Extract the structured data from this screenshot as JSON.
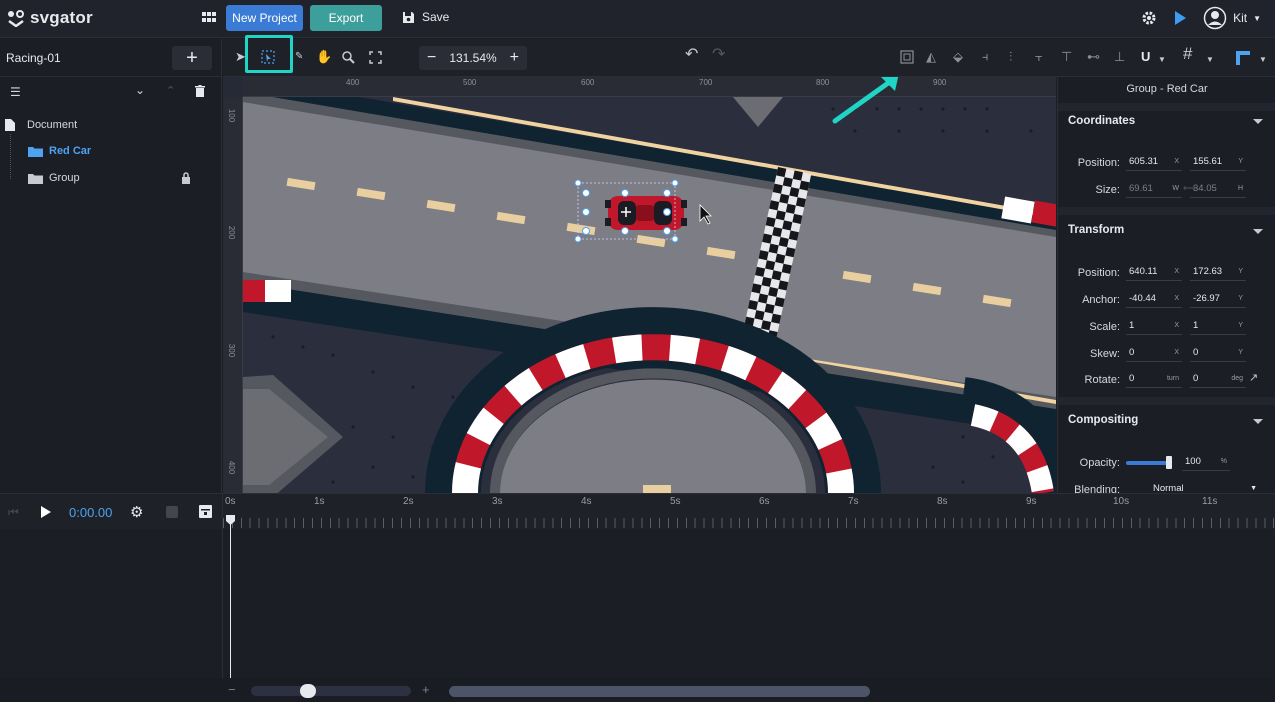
{
  "app": {
    "logo_text": "svgator"
  },
  "topbar": {
    "new_project": "New Project",
    "export": "Export",
    "save": "Save",
    "user": "Kit"
  },
  "project": {
    "name": "Racing-01"
  },
  "layers": [
    {
      "name": "Document",
      "selected": false
    },
    {
      "name": "Red Car",
      "selected": true
    },
    {
      "name": "Group",
      "locked": true
    }
  ],
  "toolbar": {
    "zoom": "131.54%"
  },
  "ruler": {
    "top": [
      "400",
      "500",
      "600",
      "700",
      "800",
      "900"
    ],
    "left": [
      "100",
      "200",
      "300",
      "400"
    ]
  },
  "inspector": {
    "title": "Group - Red Car",
    "coordinates": {
      "header": "Coordinates",
      "position_label": "Position:",
      "pos_x": "605.31",
      "pos_y": "155.61",
      "size_label": "Size:",
      "size_w": "69.61",
      "size_h": "34.05"
    },
    "transform": {
      "header": "Transform",
      "position_label": "Position:",
      "pos_x": "640.11",
      "pos_y": "172.63",
      "anchor_label": "Anchor:",
      "anchor_x": "-40.44",
      "anchor_y": "-26.97",
      "scale_label": "Scale:",
      "scale_x": "1",
      "scale_y": "1",
      "skew_label": "Skew:",
      "skew_x": "0",
      "skew_y": "0",
      "rotate_label": "Rotate:",
      "rotate_turn": "0",
      "rotate_deg": "0"
    },
    "compositing": {
      "header": "Compositing",
      "opacity_label": "Opacity:",
      "opacity_value": "100",
      "blending_label": "Blending:",
      "blending_value": "Normal"
    },
    "units": {
      "x": "X",
      "y": "Y",
      "w": "W",
      "h": "H",
      "turn": "turn",
      "deg": "deg",
      "percent": "%"
    }
  },
  "timeline": {
    "time": "0:00.00",
    "ticks": [
      "0s",
      "1s",
      "2s",
      "3s",
      "4s",
      "5s",
      "6s",
      "7s",
      "8s",
      "9s",
      "10s",
      "11s"
    ]
  },
  "colors": {
    "accent": "#3a7bd5",
    "teal": "#3c9f9b",
    "highlight": "#1fd6c6",
    "car_red": "#c0182a"
  }
}
